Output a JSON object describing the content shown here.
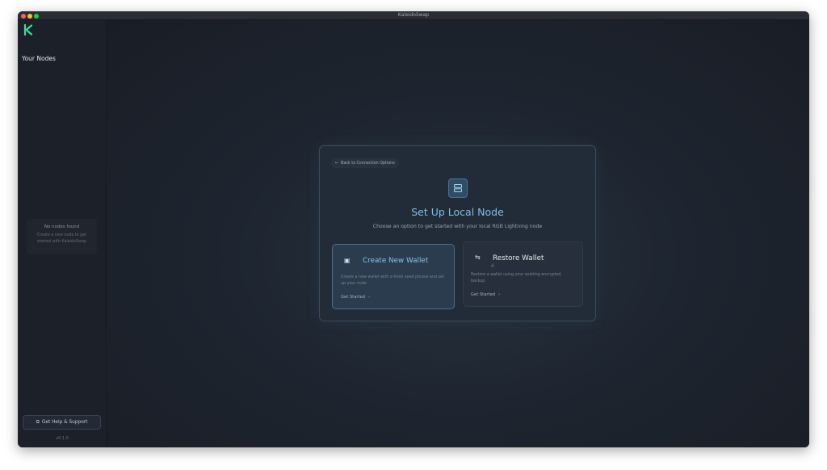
{
  "window": {
    "title": "KaleidoSwap"
  },
  "sidebar": {
    "title": "Your Nodes",
    "empty": {
      "title": "No nodes found",
      "description": "Create a new node to get started with KaleidoSwap"
    },
    "help_label": "Get Help & Support",
    "version": "v0.1.0"
  },
  "card": {
    "back_label": "Back to Connection Options",
    "title": "Set Up Local Node",
    "subtitle": "Choose an option to get started with your local RGB Lightning node",
    "options": [
      {
        "title": "Create New Wallet",
        "description": "Create a new wallet with a fresh seed phrase and set up your node",
        "link": "Get Started",
        "icon": "wallet-icon"
      },
      {
        "title": "Restore Wallet",
        "description": "Restore a wallet using your existing encrypted backup",
        "link": "Get Started",
        "icon": "swap-arrows-icon"
      }
    ]
  },
  "colors": {
    "accent": "#7fbde6",
    "logo_green": "#3ddc97",
    "background": "#1b2029"
  }
}
